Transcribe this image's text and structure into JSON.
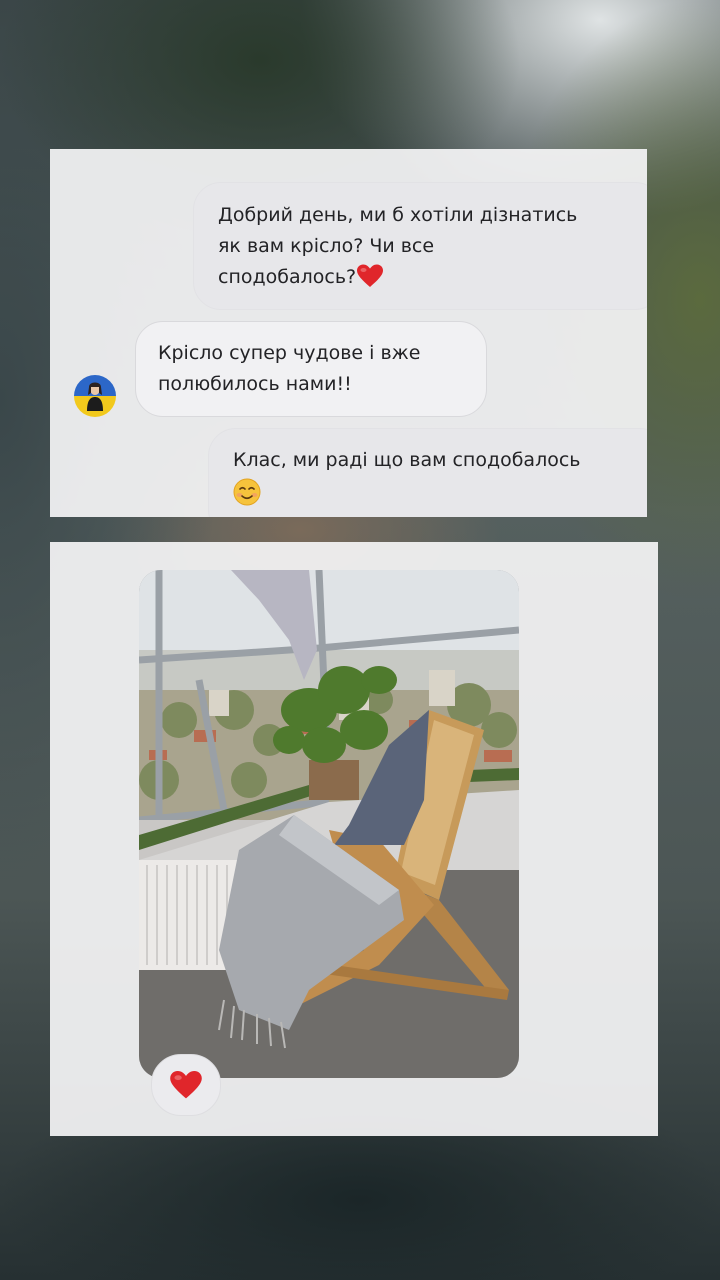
{
  "story": {
    "messages": [
      {
        "direction": "outgoing",
        "lines": [
          "Добрий день, ми б хотіли дізнатись",
          "як вам крісло? Чи все",
          "сподобалось?"
        ],
        "emoji": "red-heart"
      },
      {
        "direction": "incoming",
        "lines": [
          "Крісло супер чудове і вже",
          "полюбилось нами!!"
        ],
        "avatar": "user-avatar"
      },
      {
        "direction": "outgoing",
        "lines": [
          "Клас, ми раді що вам сподобалось"
        ],
        "emoji": "smiling-face"
      }
    ],
    "photo_message": {
      "image": "wooden lounge chair with grey blanket and cushion on a glazed balcony with plant and city view",
      "reaction": "red-heart"
    }
  },
  "colors": {
    "heart": "#e0262b",
    "bubble_outgoing": "#e7e7ea",
    "bubble_incoming": "#f1f1f3",
    "card": "#f4f4f5"
  }
}
